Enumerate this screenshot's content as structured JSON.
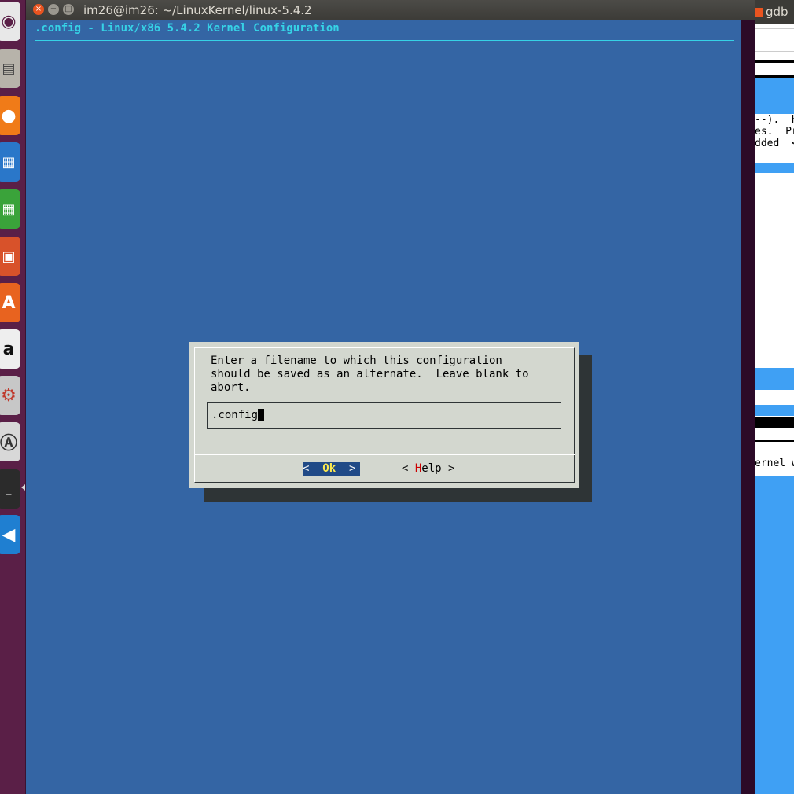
{
  "window": {
    "title": "im26@im26: ~/LinuxKernel/linux-5.4.2",
    "close_glyph": "×",
    "minimize_glyph": "−",
    "maximize_glyph": "□"
  },
  "menuconfig": {
    "header": ".config - Linux/x86 5.4.2 Kernel Configuration"
  },
  "dialog": {
    "prompt": "Enter a filename to which this configuration\nshould be saved as an alternate.  Leave blank to\nabort.",
    "input_value": ".config",
    "ok_left": "<  ",
    "ok_hot": "Ok",
    "ok_right": "  >",
    "help_left": "< ",
    "help_hot": "H",
    "help_rest": "elp >"
  },
  "background_window": {
    "title": "gdb",
    "lines": [
      "--).  H",
      "es.  Pre",
      "dded  <M",
      "ernel wi"
    ]
  },
  "launcher": {
    "items": [
      "ubuntu-dash-icon",
      "files-icon",
      "firefox-icon",
      "writer-icon",
      "calc-icon",
      "impress-icon",
      "software-center-icon",
      "amazon-icon",
      "system-settings-icon",
      "software-updater-icon",
      "terminal-icon",
      "vscode-icon"
    ]
  },
  "colors": {
    "terminal_bg": "#3465a4",
    "header_fg": "#36d2e6",
    "dialog_bg": "#d3d7cf",
    "button_selected_bg": "#204a87",
    "hotkey_selected": "#fce94f",
    "hotkey": "#cc0000"
  }
}
